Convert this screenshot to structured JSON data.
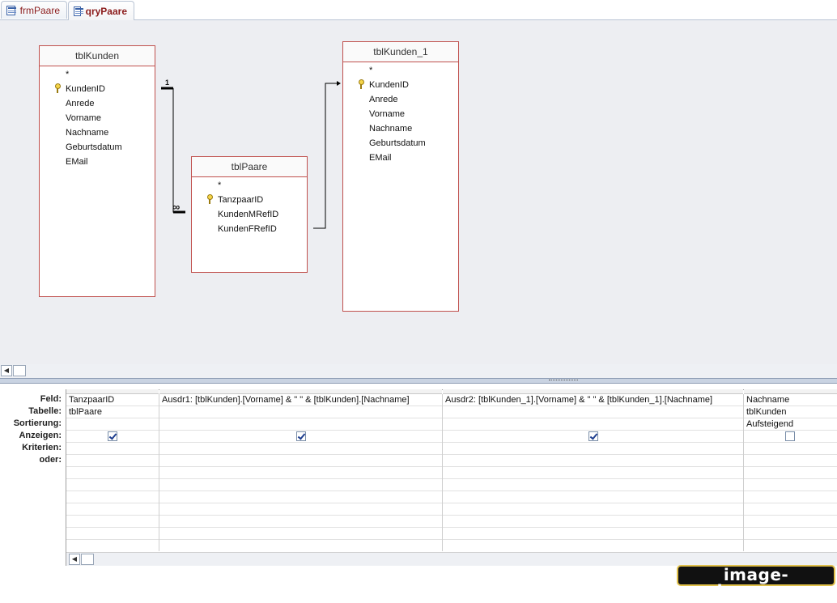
{
  "tabs": [
    {
      "label": "frmPaare",
      "icon": "form-icon",
      "active": false
    },
    {
      "label": "qryPaare",
      "icon": "query-icon",
      "active": true
    }
  ],
  "design": {
    "tables": [
      {
        "name": "tblKunden",
        "fields": [
          "*",
          "KundenID",
          "Anrede",
          "Vorname",
          "Nachname",
          "Geburtsdatum",
          "EMail"
        ],
        "key_field": "KundenID"
      },
      {
        "name": "tblPaare",
        "fields": [
          "*",
          "TanzpaarID",
          "KundenMRefID",
          "KundenFRefID"
        ],
        "key_field": "TanzpaarID"
      },
      {
        "name": "tblKunden_1",
        "fields": [
          "*",
          "KundenID",
          "Anrede",
          "Vorname",
          "Nachname",
          "Geburtsdatum",
          "EMail"
        ],
        "key_field": "KundenID"
      }
    ],
    "relationships": [
      {
        "from": "tblKunden.KundenID",
        "to": "tblPaare.KundenMRefID",
        "one_label": "1",
        "many_label": "∞"
      },
      {
        "from": "tblPaare.KundenFRefID",
        "to": "tblKunden_1.KundenID",
        "type": "join-arrow"
      }
    ]
  },
  "qbe": {
    "row_labels": [
      "Feld:",
      "Tabelle:",
      "Sortierung:",
      "Anzeigen:",
      "Kriterien:",
      "oder:"
    ],
    "columns": [
      {
        "feld": "TanzpaarID",
        "tabelle": "tblPaare",
        "sortierung": "",
        "anzeigen": true
      },
      {
        "feld": "Ausdr1: [tblKunden].[Vorname] & \" \" & [tblKunden].[Nachname]",
        "tabelle": "",
        "sortierung": "",
        "anzeigen": true
      },
      {
        "feld": "Ausdr2: [tblKunden_1].[Vorname] & \" \" & [tblKunden_1].[Nachname]",
        "tabelle": "",
        "sortierung": "",
        "anzeigen": true
      },
      {
        "feld": "Nachname",
        "tabelle": "tblKunden",
        "sortierung": "Aufsteigend",
        "anzeigen": false
      }
    ]
  },
  "watermark": "image-share.com"
}
